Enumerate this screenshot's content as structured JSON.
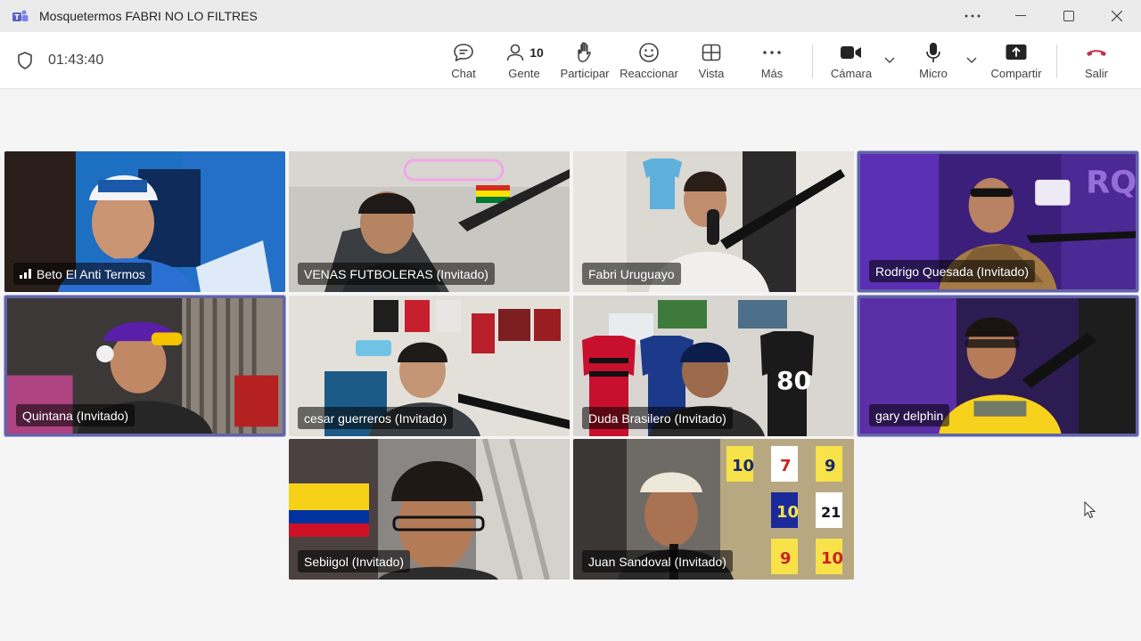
{
  "window": {
    "title": "Mosquetermos FABRI NO LO FILTRES",
    "app_icon": "teams-icon"
  },
  "toolbar": {
    "timer": "01:43:40",
    "chat_label": "Chat",
    "people_label": "Gente",
    "people_count": "10",
    "raise_label": "Participar",
    "react_label": "Reaccionar",
    "view_label": "Vista",
    "more_label": "Más",
    "camera_label": "Cámara",
    "mic_label": "Micro",
    "share_label": "Compartir",
    "leave_label": "Salir",
    "leave_color": "#c4314b"
  },
  "participants": [
    {
      "name": "Beto El Anti Termos",
      "active_speaker": false,
      "signal_icon": true
    },
    {
      "name": "VENAS FUTBOLERAS (Invitado)",
      "active_speaker": false
    },
    {
      "name": "Fabri Uruguayo",
      "active_speaker": false
    },
    {
      "name": "Rodrigo Quesada (Invitado)",
      "active_speaker": true
    },
    {
      "name": "Quintana (Invitado)",
      "active_speaker": true
    },
    {
      "name": "cesar guerreros (Invitado)",
      "active_speaker": false
    },
    {
      "name": "Duda Brasilero (Invitado)",
      "active_speaker": false
    },
    {
      "name": "gary delphin",
      "active_speaker": true
    },
    {
      "name": "Sebiigol (Invitado)",
      "active_speaker": false
    },
    {
      "name": "Juan Sandoval (Invitado)",
      "active_speaker": false
    }
  ],
  "accent_color": "#6264a7"
}
